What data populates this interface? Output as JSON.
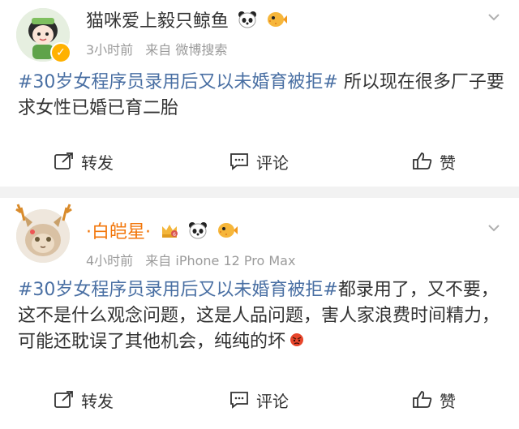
{
  "posts": [
    {
      "username": "猫咪爱上毅只鲸鱼",
      "time": "3小时前",
      "source": "来自 微博搜索",
      "hashtag": "#30岁女程序员录用后又以未婚育被拒#",
      "text": " 所以现在很多厂子要求女性已婚已育二胎",
      "actions": {
        "repost": "转发",
        "comment": "评论",
        "like": "赞"
      }
    },
    {
      "username": "·白皑星·",
      "time": "4小时前",
      "source": "来自 iPhone 12 Pro Max",
      "hashtag": "#30岁女程序员录用后又以未婚育被拒#",
      "text": "都录用了，又不要，这不是什么观念问题，这是人品问题，害人家浪费时间精力，可能还耽误了其他机会，纯纯的坏",
      "actions": {
        "repost": "转发",
        "comment": "评论",
        "like": "赞"
      }
    }
  ],
  "colors": {
    "hashtag": "#496fa3",
    "vip_name": "#f2760a",
    "divider": "#f2f2f2"
  },
  "icons": [
    "panda-icon",
    "pufferfish-icon",
    "crown-badge-icon",
    "angry-face-icon",
    "repost-icon",
    "comment-icon",
    "like-icon",
    "chevron-down-icon",
    "verified-icon"
  ]
}
